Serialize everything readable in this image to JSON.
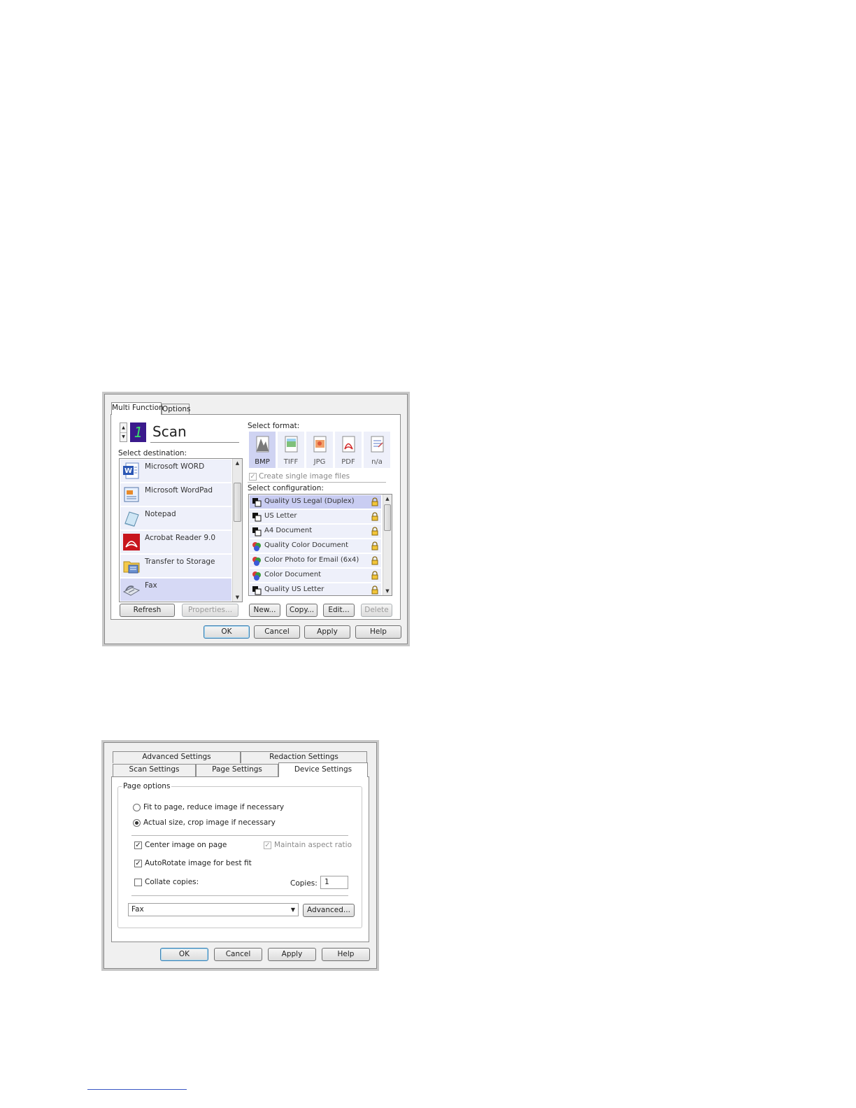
{
  "dialog1": {
    "tabs": [
      {
        "label": "Multi Function"
      },
      {
        "label": "Options"
      }
    ],
    "counter_value": "1",
    "mode_title": "Scan",
    "select_destination_label": "Select destination:",
    "destinations": [
      {
        "label": "Microsoft WORD",
        "icon": "word-icon"
      },
      {
        "label": "Microsoft WordPad",
        "icon": "wordpad-icon"
      },
      {
        "label": "Notepad",
        "icon": "notepad-icon"
      },
      {
        "label": "Acrobat Reader 9.0",
        "icon": "acrobat-icon"
      },
      {
        "label": "Transfer to Storage",
        "icon": "storage-icon"
      },
      {
        "label": "Fax",
        "icon": "fax-icon",
        "selected": true
      }
    ],
    "select_format_label": "Select format:",
    "formats": [
      {
        "label": "BMP",
        "selected": true
      },
      {
        "label": "TIFF"
      },
      {
        "label": "JPG"
      },
      {
        "label": "PDF"
      },
      {
        "label": "n/a"
      }
    ],
    "create_single_label": "Create single image files",
    "select_configuration_label": "Select configuration:",
    "configurations": [
      {
        "label": "Quality US Legal (Duplex)",
        "selected": true,
        "color": false
      },
      {
        "label": "US Letter",
        "color": false
      },
      {
        "label": "A4 Document",
        "color": false
      },
      {
        "label": "Quality Color Document",
        "color": true
      },
      {
        "label": "Color Photo for Email (6x4)",
        "color": true
      },
      {
        "label": "Color Document",
        "color": true
      },
      {
        "label": "Quality US Letter",
        "color": false
      }
    ],
    "buttons": {
      "refresh": "Refresh",
      "properties": "Properties...",
      "new": "New...",
      "copy": "Copy...",
      "edit": "Edit...",
      "delete": "Delete",
      "ok": "OK",
      "cancel": "Cancel",
      "apply": "Apply",
      "help": "Help"
    }
  },
  "dialog2": {
    "tabs_row1": [
      {
        "label": "Advanced Settings"
      },
      {
        "label": "Redaction Settings"
      }
    ],
    "tabs_row2": [
      {
        "label": "Scan Settings"
      },
      {
        "label": "Page Settings"
      },
      {
        "label": "Device Settings",
        "active": true
      }
    ],
    "group_title": "Page options",
    "radio_fit": "Fit to page, reduce image if necessary",
    "radio_actual": "Actual size, crop image if necessary",
    "center_label": "Center image on page",
    "maintain_label": "Maintain aspect ratio",
    "autorotate_label": "AutoRotate image for best fit",
    "collate_label": "Collate copies:",
    "copies_label": "Copies:",
    "copies_value": "1",
    "device_value": "Fax",
    "buttons": {
      "advanced": "Advanced...",
      "ok": "OK",
      "cancel": "Cancel",
      "apply": "Apply",
      "help": "Help"
    }
  },
  "colors": {
    "list_bg": "#eef0fa",
    "list_selected": "#c9cdf2",
    "scan_badge": "#3a1a8c",
    "scan_badge_digit": "#39e06a"
  }
}
